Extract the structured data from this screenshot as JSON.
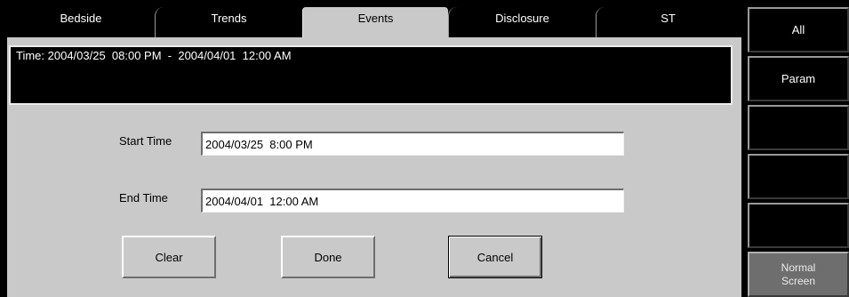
{
  "tabs": [
    {
      "label": "Bedside",
      "active": false
    },
    {
      "label": "Trends",
      "active": false
    },
    {
      "label": "Events",
      "active": true
    },
    {
      "label": "Disclosure",
      "active": false
    },
    {
      "label": "ST",
      "active": false
    }
  ],
  "time_range_text": "Time: 2004/03/25  08:00 PM  -  2004/04/01  12:00 AM",
  "start_time": {
    "label": "Start Time",
    "value": "2004/03/25  8:00 PM"
  },
  "end_time": {
    "label": "End Time",
    "value": "2004/04/01  12:00 AM"
  },
  "buttons": {
    "clear": "Clear",
    "done": "Done",
    "cancel": "Cancel"
  },
  "sidebar": {
    "all": "All",
    "param": "Param",
    "blank1": "",
    "blank2": "",
    "blank3": "",
    "normal_screen": "Normal\nScreen"
  },
  "colors": {
    "background": "#000000",
    "panel": "#c9c9c9",
    "active_tab": "#c9c9c9",
    "normal_screen_button": "#6e6e6e"
  }
}
